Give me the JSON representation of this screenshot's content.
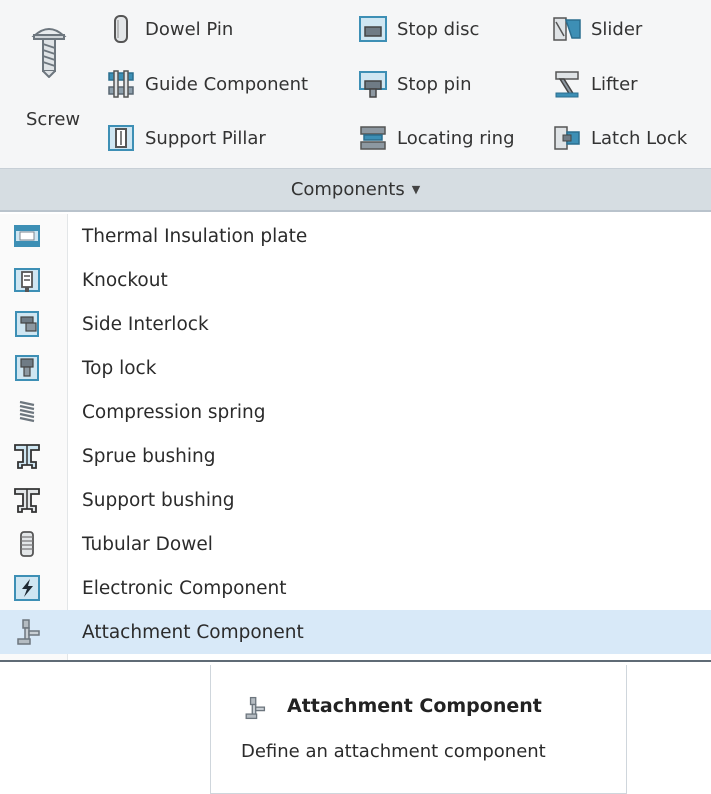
{
  "ribbon": {
    "screw_label": "Screw",
    "col1": [
      {
        "label": "Dowel Pin",
        "icon": "dowel-pin-icon"
      },
      {
        "label": "Guide Component",
        "icon": "guide-component-icon"
      },
      {
        "label": "Support Pillar",
        "icon": "support-pillar-icon"
      }
    ],
    "col2": [
      {
        "label": "Stop disc",
        "icon": "stop-disc-icon"
      },
      {
        "label": "Stop pin",
        "icon": "stop-pin-icon"
      },
      {
        "label": "Locating ring",
        "icon": "locating-ring-icon"
      }
    ],
    "col3": [
      {
        "label": "Slider",
        "icon": "slider-icon"
      },
      {
        "label": "Lifter",
        "icon": "lifter-icon"
      },
      {
        "label": "Latch Lock",
        "icon": "latch-lock-icon"
      }
    ],
    "group_label": "Components",
    "group_caret": "▼"
  },
  "menu": {
    "items": [
      {
        "label": "Thermal Insulation plate",
        "icon": "thermal-insulation-plate-icon"
      },
      {
        "label": "Knockout",
        "icon": "knockout-icon"
      },
      {
        "label": "Side Interlock",
        "icon": "side-interlock-icon"
      },
      {
        "label": "Top lock",
        "icon": "top-lock-icon"
      },
      {
        "label": "Compression spring",
        "icon": "compression-spring-icon"
      },
      {
        "label": "Sprue bushing",
        "icon": "sprue-bushing-icon"
      },
      {
        "label": "Support bushing",
        "icon": "support-bushing-icon"
      },
      {
        "label": "Tubular Dowel",
        "icon": "tubular-dowel-icon"
      },
      {
        "label": "Electronic Component",
        "icon": "electronic-component-icon"
      },
      {
        "label": "Attachment Component",
        "icon": "attachment-component-icon"
      }
    ],
    "highlighted_index": 9
  },
  "tooltip": {
    "title": "Attachment Component",
    "description": "Define an attachment component"
  },
  "colors": {
    "ribbon_bg": "#f5f6f7",
    "group_bg": "#d6dde2",
    "highlight": "#d8e9f8",
    "icon_teal": "#3d8fb5",
    "icon_gray": "#7d8790"
  }
}
